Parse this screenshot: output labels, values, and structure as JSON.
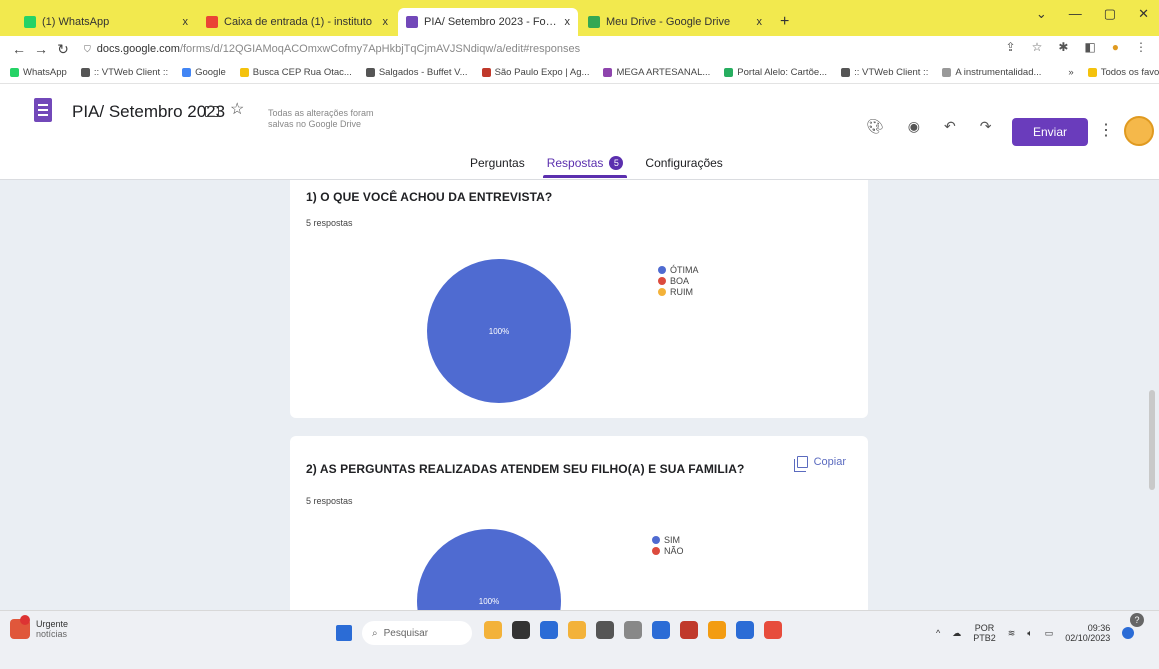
{
  "browser": {
    "tabs": [
      {
        "label": "(1) WhatsApp",
        "color": "#25d366",
        "active": false
      },
      {
        "label": "Caixa de entrada (1) - instituto",
        "color": "#ea4335",
        "active": false
      },
      {
        "label": "PIA/ Setembro 2023 - Formulá",
        "color": "#7248b9",
        "active": true
      },
      {
        "label": "Meu Drive - Google Drive",
        "color": "#34a853",
        "active": false
      }
    ],
    "tab_close": "x",
    "new_tab": "+",
    "url_host": "docs.google.com",
    "url_path": "/forms/d/12QGIAMoqACOmxwCofmy7ApHkbjTqCjmAVJSNdiqw/a/edit#responses",
    "bookmarks": [
      {
        "label": "WhatsApp",
        "color": "#25d366"
      },
      {
        "label": ":: VTWeb Client ::",
        "color": "#555555"
      },
      {
        "label": "Google",
        "color": "#4285f4"
      },
      {
        "label": "Busca CEP Rua Otac...",
        "color": "#f4c20d"
      },
      {
        "label": "Salgados - Buffet V...",
        "color": "#555555"
      },
      {
        "label": "São Paulo Expo | Ag...",
        "color": "#c0392b"
      },
      {
        "label": "MEGA ARTESANAL...",
        "color": "#8e44ad"
      },
      {
        "label": "Portal Alelo: Cartõe...",
        "color": "#27ae60"
      },
      {
        "label": ":: VTWeb Client ::",
        "color": "#555555"
      },
      {
        "label": "A instrumentalidad...",
        "color": "#999999"
      },
      {
        "label": "»",
        "color": "transparent"
      },
      {
        "label": "Todos os favoritos",
        "color": "#f4c20d"
      }
    ]
  },
  "form": {
    "title": "PIA/ Setembro 2023",
    "saved_note": "Todas as alterações foram salvas no Google Drive",
    "send_label": "Enviar",
    "tabs": [
      {
        "label": "Perguntas",
        "active": false
      },
      {
        "label": "Respostas",
        "active": true,
        "badge": "5"
      },
      {
        "label": "Configurações",
        "active": false
      }
    ]
  },
  "questions": [
    {
      "title": "1) O QUE VOCÊ ACHOU DA ENTREVISTA?",
      "responses": "5 respostas",
      "copy_label": "",
      "legend": [
        {
          "label": "ÓTIMA",
          "color": "#4f6bd1"
        },
        {
          "label": "BOA",
          "color": "#dc4b3e"
        },
        {
          "label": "RUIM",
          "color": "#f3b23a"
        }
      ]
    },
    {
      "title": "2) AS PERGUNTAS REALIZADAS ATENDEM SEU FILHO(A) E SUA FAMILIA?",
      "responses": "5 respostas",
      "copy_label": "Copiar",
      "legend": [
        {
          "label": "SIM",
          "color": "#4f6bd1"
        },
        {
          "label": "NÃO",
          "color": "#dc4b3e"
        }
      ]
    }
  ],
  "chart_data": [
    {
      "type": "pie",
      "labels": [
        "ÓTIMA",
        "BOA",
        "RUIM"
      ],
      "values": [
        100,
        0,
        0
      ],
      "data_labels": [
        "100%"
      ],
      "colors": [
        "#4f6bd1",
        "#dc4b3e",
        "#f3b23a"
      ],
      "legend": "right"
    },
    {
      "type": "pie",
      "labels": [
        "SIM",
        "NÃO"
      ],
      "values": [
        100,
        0
      ],
      "data_labels": [
        "100%"
      ],
      "colors": [
        "#4f6bd1",
        "#dc4b3e"
      ],
      "legend": "right"
    }
  ],
  "taskbar": {
    "news_title": "Urgente",
    "news_sub": "notícias",
    "search_placeholder": "Pesquisar",
    "lang_top": "POR",
    "lang_bottom": "PTB2",
    "time": "09:36",
    "date": "02/10/2023",
    "app_colors": [
      "#f3b23a",
      "#333333",
      "#2b6cd6",
      "#f3b23a",
      "#555555",
      "#888888",
      "#2b6cd6",
      "#c0392b",
      "#f39c12",
      "#2b6cd6",
      "#e74c3c"
    ]
  }
}
